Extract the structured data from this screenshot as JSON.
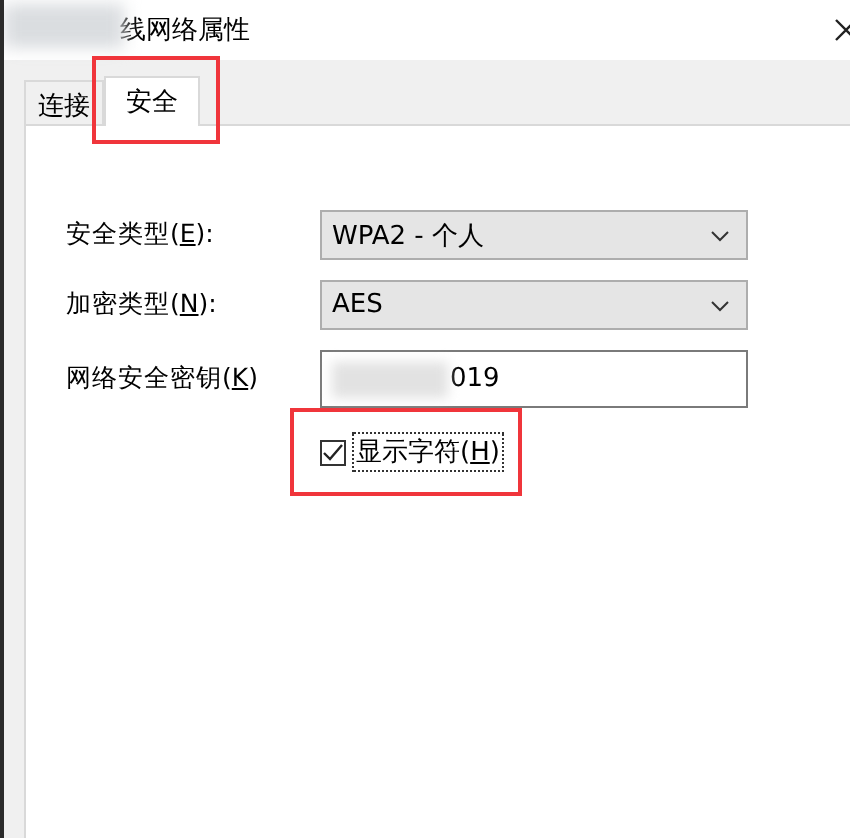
{
  "window": {
    "title": "线网络属性",
    "title_redacted": true
  },
  "tabs": [
    {
      "label": "连接",
      "selected": false,
      "annotated": false
    },
    {
      "label": "安全",
      "selected": true,
      "annotated": true
    }
  ],
  "fields": [
    {
      "kind": "dropdown",
      "label_before": "安全类型(",
      "access_key": "E",
      "label_after": "):",
      "value": "WPA2 - 个人"
    },
    {
      "kind": "dropdown",
      "label_before": "加密类型(",
      "access_key": "N",
      "label_after": "):",
      "value": "AES"
    },
    {
      "kind": "text",
      "label_before": "网络安全密钥(",
      "access_key": "K",
      "label_after": ")",
      "value": "019",
      "value_redacted": true
    }
  ],
  "show_characters": {
    "label_before": "显示字符(",
    "access_key": "H",
    "label_after": ")",
    "checked": true,
    "annotated": true
  }
}
